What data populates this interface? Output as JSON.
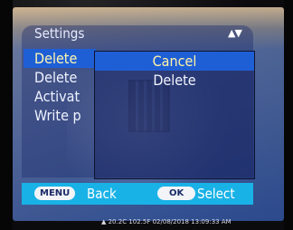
{
  "settings_menu": {
    "title": "Settings",
    "scroll_indicator": "▲▼",
    "items": [
      {
        "label": "Delete"
      },
      {
        "label": "Delete"
      },
      {
        "label": "Activat"
      },
      {
        "label": "Write p"
      }
    ]
  },
  "confirm_dialog": {
    "options": [
      {
        "label": "Cancel"
      },
      {
        "label": "Delete"
      }
    ]
  },
  "bottom_bar": {
    "menu_key": "MENU",
    "menu_action": "Back",
    "ok_key": "OK",
    "ok_action": "Select"
  },
  "status_strip": {
    "text": "▲ 20.2C 102.5F 02/08/2018 13:09:33 AM"
  },
  "colors": {
    "highlight": "#1f5fd6",
    "bottom_bar": "#19b2e6",
    "dialog_text": "#fff2a8"
  }
}
